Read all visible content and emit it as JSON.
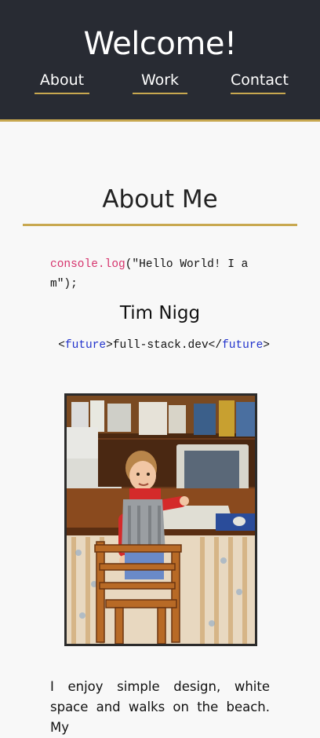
{
  "header": {
    "title": "Welcome!",
    "nav": [
      {
        "label": "About"
      },
      {
        "label": "Work"
      },
      {
        "label": "Contact"
      }
    ]
  },
  "about": {
    "heading": "About Me",
    "code_hello": {
      "fn": "console.log",
      "args": "(\"Hello World! I am\");"
    },
    "name": "Tim Nigg",
    "code_future": {
      "open_lt": "<",
      "open_tag": "future",
      "open_gt": ">",
      "text": "full-stack.dev",
      "close_lt": "</",
      "close_tag": "future",
      "close_gt": ">"
    },
    "paragraph": "I enjoy simple design, white space and walks on the beach. My"
  },
  "colors": {
    "header_bg": "#282b33",
    "accent": "#c8a850",
    "page_bg": "#f8f8f8",
    "code_function": "#d6336c",
    "code_tag": "#2233cc"
  }
}
